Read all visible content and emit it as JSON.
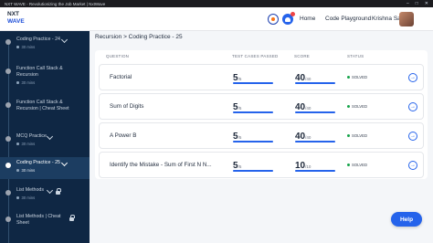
{
  "window": {
    "title": "NXT WAVE - Revolutionizing the Job Market | NxtWave",
    "controls": [
      "–",
      "□",
      "✕"
    ]
  },
  "header": {
    "logo_line1": "NXT",
    "logo_line2": "WAVE",
    "links": [
      "Home",
      "Code Playground"
    ],
    "user_name": "Krishna Sai"
  },
  "sidebar": {
    "items": [
      {
        "label": "Coding Practice - 24",
        "duration": "30 mins",
        "icon": "pencil-icon"
      },
      {
        "label": "Function Call Stack & Recursion",
        "duration": "30 mins",
        "icon": ""
      },
      {
        "label": "Function Call Stack & Recursion | Cheat Sheet",
        "duration": "",
        "icon": ""
      },
      {
        "label": "MCQ Practice",
        "duration": "30 mins",
        "icon": "pencil-icon"
      },
      {
        "label": "Coding Practice - 25",
        "duration": "30 mins",
        "icon": "pencil-icon"
      },
      {
        "label": "List Methods",
        "duration": "30 mins",
        "icon": "lock-icon"
      },
      {
        "label": "List Methods | Cheat Sheet",
        "duration": "",
        "icon": "lock-icon"
      }
    ]
  },
  "breadcrumb": "Recursion > Coding Practice - 25",
  "table": {
    "headers": [
      "QUESTION",
      "TEST CASES PASSED",
      "SCORE",
      "STATUS"
    ],
    "rows": [
      {
        "question": "Factorial",
        "passed": "5",
        "total_cases": "/5",
        "score": "40",
        "max_score": "/40",
        "status": "SOLVED",
        "progress": 1.0
      },
      {
        "question": "Sum of Digits",
        "passed": "5",
        "total_cases": "/5",
        "score": "40",
        "max_score": "/40",
        "status": "SOLVED",
        "progress": 1.0
      },
      {
        "question": "A Power B",
        "passed": "5",
        "total_cases": "/5",
        "score": "40",
        "max_score": "/40",
        "status": "SOLVED",
        "progress": 1.0
      },
      {
        "question": "Identify the Mistake - Sum of First N N...",
        "passed": "5",
        "total_cases": "/5",
        "score": "10",
        "max_score": "/10",
        "status": "SOLVED",
        "progress": 1.0
      }
    ]
  },
  "help_label": "Help",
  "colors": {
    "accent": "#2563eb",
    "sidebar_bg": "#0f2744",
    "sidebar_active": "#1c3d61",
    "solved": "#16a34a"
  }
}
